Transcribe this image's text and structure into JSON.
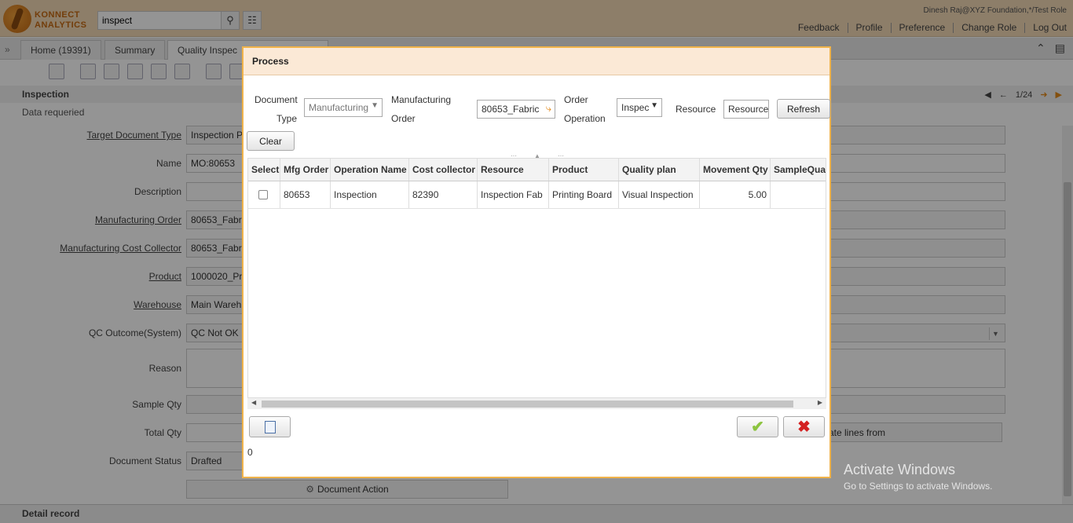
{
  "app": {
    "logo_line1": "KONNECT",
    "logo_line2": "ANALYTICS"
  },
  "search": {
    "value": "inspect"
  },
  "user": {
    "line": "Dinesh Raj@XYZ Foundation,*/Test Role"
  },
  "top_links": [
    "Feedback",
    "Profile",
    "Preference",
    "Change Role",
    "Log Out"
  ],
  "tabs": [
    {
      "label": "Home (19391)"
    },
    {
      "label": "Summary"
    },
    {
      "label": "Quality Inspec"
    }
  ],
  "section": {
    "title": "Inspection",
    "subtitle": "Data requeried",
    "pager": "1/24"
  },
  "form": {
    "target_doc_type": {
      "label": "Target Document Type",
      "value": "Inspection P"
    },
    "name": {
      "label": "Name",
      "value": "MO:80653"
    },
    "description": {
      "label": "Description",
      "value": ""
    },
    "mfg_order": {
      "label": "Manufacturing Order",
      "value": "80653_Fabr"
    },
    "mfg_cost_collector": {
      "label": "Manufacturing Cost Collector",
      "value": "80653_Fabr"
    },
    "product": {
      "label": "Product",
      "value": "1000020_Pr"
    },
    "warehouse": {
      "label": "Warehouse",
      "value": "Main Wareh"
    },
    "qc_outcome": {
      "label": "QC Outcome(System)",
      "value": "QC Not OK"
    },
    "reason": {
      "label": "Reason",
      "value": ""
    },
    "sample_qty": {
      "label": "Sample Qty",
      "value": ""
    },
    "total_qty": {
      "label": "Total Qty",
      "value": ""
    },
    "doc_status": {
      "label": "Document Status",
      "value": "Drafted"
    },
    "doc_action": "Document Action",
    "template_btn": "ate lines from"
  },
  "detail_bar": "Detail record",
  "watermark": {
    "line1": "Activate Windows",
    "line2": "Go to Settings to activate Windows."
  },
  "dialog": {
    "title": "Process",
    "params": {
      "doc_type_label1": "Document",
      "doc_type_label2": "Type",
      "doc_type_value": "Manufacturing",
      "mo_label1": "Manufacturing",
      "mo_label2": "Order",
      "mo_value": "80653_Fabric",
      "op_label1": "Order",
      "op_label2": "Operation",
      "op_value": "Inspec",
      "resource_label": "Resource",
      "resource_value": "Resource",
      "refresh": "Refresh",
      "clear": "Clear"
    },
    "grid": {
      "headers": [
        "Select",
        "Mfg Order",
        "Operation Name",
        "Cost collector",
        "Resource",
        "Product",
        "Quality plan",
        "Movement Qty",
        "SampleQua"
      ],
      "rows": [
        [
          "",
          "80653",
          "Inspection",
          "82390",
          "Inspection Fab",
          "Printing Board",
          "Visual Inspection",
          "5.00",
          ""
        ]
      ]
    },
    "count": "0"
  },
  "colors": {
    "accent": "#f0b34a",
    "topbar": "#f3d9b6",
    "ok": "#8cc43f",
    "cancel": "#d42222"
  }
}
